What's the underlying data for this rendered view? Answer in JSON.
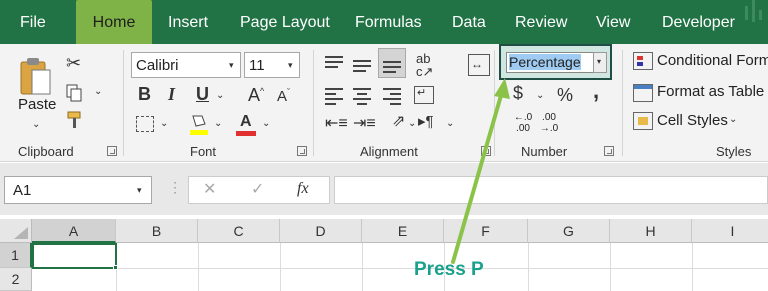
{
  "menu": {
    "items": [
      "File",
      "Home",
      "Insert",
      "Page Layout",
      "Formulas",
      "Data",
      "Review",
      "View",
      "Developer"
    ],
    "active": "Home"
  },
  "clipboard": {
    "paste_label": "Paste",
    "group_label": "Clipboard"
  },
  "font": {
    "name": "Calibri",
    "size": "11",
    "group_label": "Font",
    "bold": "B",
    "italic": "I",
    "underline": "U"
  },
  "alignment": {
    "group_label": "Alignment"
  },
  "number": {
    "format": "Percentage",
    "group_label": "Number",
    "currency": "$",
    "percent": "%",
    "comma": ",",
    "inc_decimal": [
      "←.0",
      ".00"
    ],
    "dec_decimal": [
      ".00",
      "→.0"
    ]
  },
  "styles": {
    "conditional": "Conditional Form",
    "format_table": "Format as Table",
    "cell_styles": "Cell Styles",
    "group_label": "Styles"
  },
  "formula_bar": {
    "name_box": "A1",
    "fx": "fx",
    "cancel": "✕",
    "enter": "✓"
  },
  "grid": {
    "columns": [
      "A",
      "B",
      "C",
      "D",
      "E",
      "F",
      "G",
      "H",
      "I"
    ],
    "rows": [
      "1",
      "2"
    ],
    "selected_cell": "A1"
  },
  "annotation": {
    "text": "Press P"
  },
  "colors": {
    "brand": "#217346",
    "active_tab": "#7fb347",
    "annotation": "#1aa08c",
    "arrow": "#8bc34a"
  }
}
